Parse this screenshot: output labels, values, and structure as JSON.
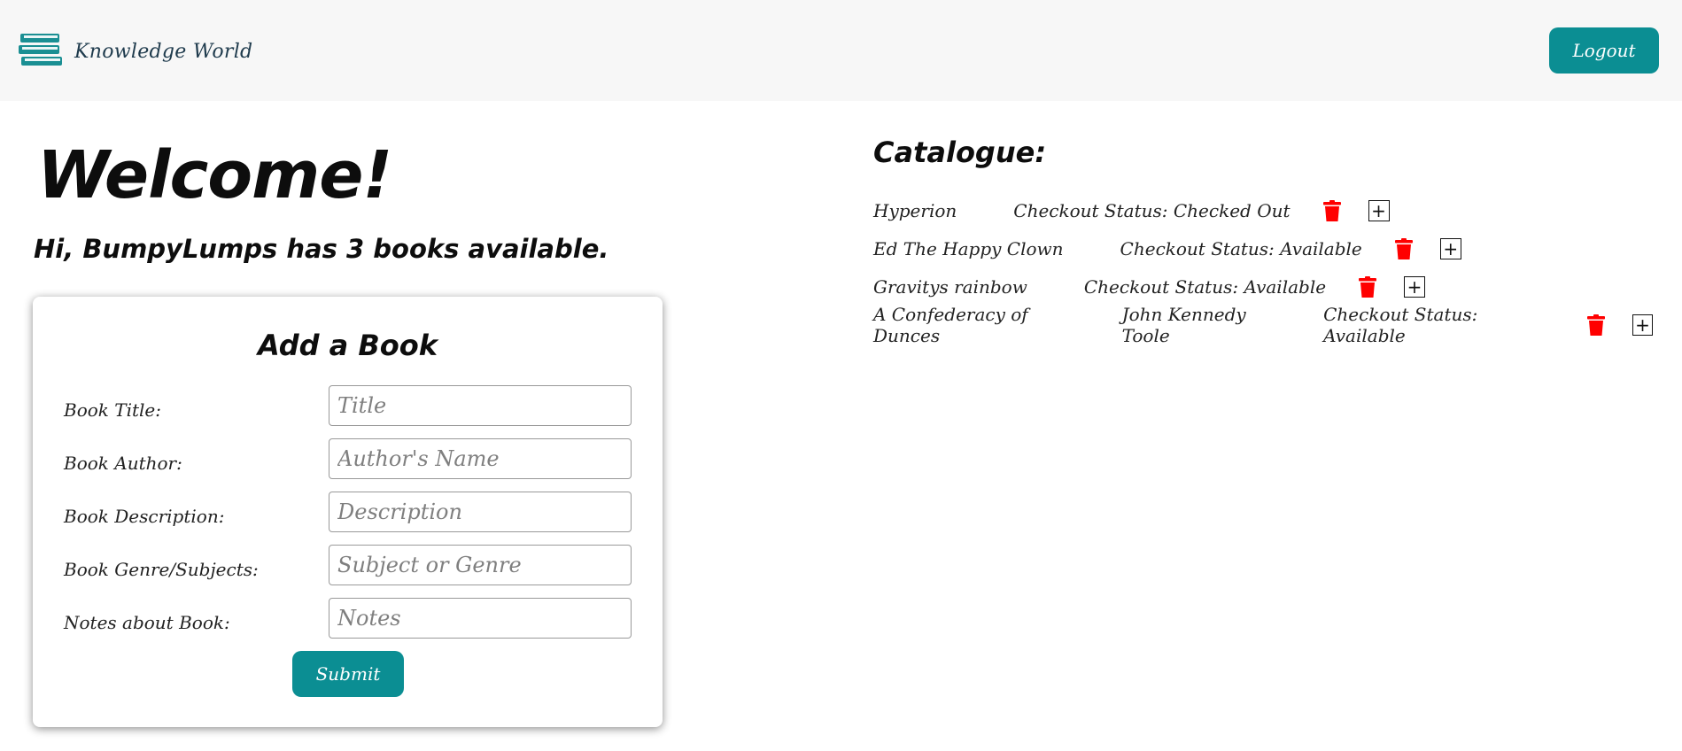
{
  "header": {
    "brand_name": "Knowledge World",
    "brand_icon": "books-stack-icon",
    "logout_label": "Logout"
  },
  "main": {
    "welcome": "Welcome!",
    "greeting": "Hi, BumpyLumps has 3 books available."
  },
  "add_book_form": {
    "title": "Add a Book",
    "fields": [
      {
        "label": "Book Title:",
        "placeholder": "Title"
      },
      {
        "label": "Book Author:",
        "placeholder": "Author's Name"
      },
      {
        "label": "Book Description:",
        "placeholder": "Description"
      },
      {
        "label": "Book Genre/Subjects:",
        "placeholder": "Subject or Genre"
      },
      {
        "label": "Notes about Book:",
        "placeholder": "Notes"
      }
    ],
    "submit_label": "Submit"
  },
  "catalogue": {
    "title": "Catalogue:",
    "books": [
      {
        "title": "Hyperion",
        "author": "",
        "status": "Checkout Status: Checked Out"
      },
      {
        "title": "Ed The Happy Clown",
        "author": "",
        "status": "Checkout Status: Available"
      },
      {
        "title": "Gravitys rainbow",
        "author": "",
        "status": "Checkout Status: Available"
      },
      {
        "title": "A Confederacy of Dunces",
        "author": "John Kennedy Toole",
        "status": "Checkout Status: Available"
      }
    ],
    "delete_icon": "trash-icon",
    "add_icon": "plus-icon",
    "add_symbol": "+"
  },
  "colors": {
    "accent": "#0b8e93",
    "delete": "#ff0000",
    "header_bg": "#f7f7f7"
  }
}
